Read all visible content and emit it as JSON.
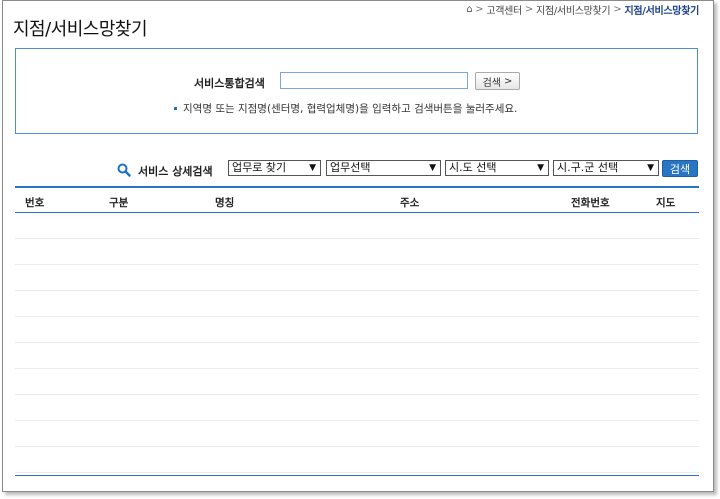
{
  "breadcrumb": {
    "home_icon": "home-icon",
    "items": [
      "고객센터",
      "지점/서비스망찾기"
    ],
    "current": "지점/서비스망찾기"
  },
  "page_title": "지점/서비스망찾기",
  "integrated_search": {
    "label": "서비스통합검색",
    "input_value": "",
    "button_label": "검색",
    "button_arrow": ">",
    "hint": "지역명 또는 지점명(센터명, 협력업체명)을 입력하고 검색버튼을 눌러주세요."
  },
  "detail_search": {
    "label": "서비스 상세검색",
    "selects": [
      {
        "name": "find-by-task-select",
        "value": "업무로 찾기"
      },
      {
        "name": "task-select",
        "value": "업무선택"
      },
      {
        "name": "city-select",
        "value": "시.도 선택"
      },
      {
        "name": "district-select",
        "value": "시.구.군 선택"
      }
    ],
    "button_label": "검색"
  },
  "table": {
    "columns": [
      "번호",
      "구분",
      "명칭",
      "주소",
      "전화번호",
      "지도"
    ],
    "rows": []
  },
  "colors": {
    "accent": "#2a74c4",
    "title_current": "#1a3f8a"
  }
}
